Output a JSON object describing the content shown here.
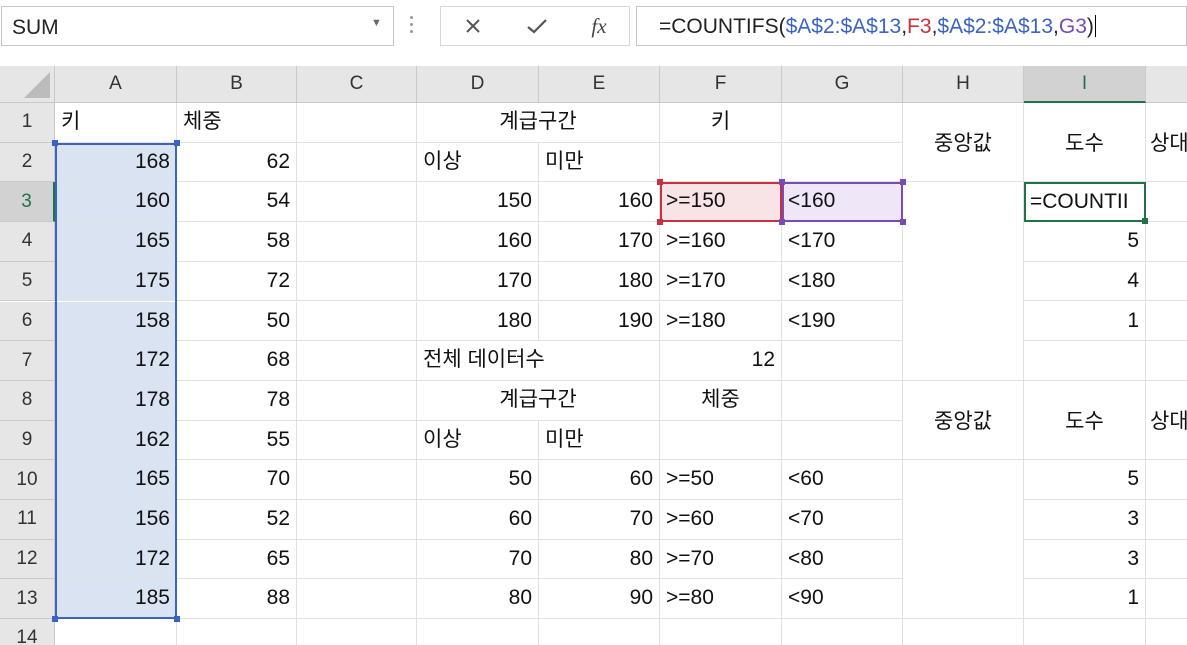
{
  "formula_bar": {
    "name_box": "SUM",
    "cancel_icon": "✕",
    "enter_icon": "✓",
    "fx_label": "fx",
    "formula_parts": [
      {
        "text": "=COUNTIFS(",
        "color": "#222222"
      },
      {
        "text": "$A$2:$A$13",
        "color": "#3b63c6"
      },
      {
        "text": ",",
        "color": "#222222"
      },
      {
        "text": "F3",
        "color": "#c8313f"
      },
      {
        "text": ",",
        "color": "#222222"
      },
      {
        "text": "$A$2:$A$13",
        "color": "#3b63c6"
      },
      {
        "text": ",",
        "color": "#222222"
      },
      {
        "text": "G3",
        "color": "#7a4bb3"
      },
      {
        "text": ")",
        "color": "#222222"
      }
    ]
  },
  "columns": [
    "A",
    "B",
    "C",
    "D",
    "E",
    "F",
    "G",
    "H",
    "I"
  ],
  "rows": [
    "1",
    "2",
    "3",
    "4",
    "5",
    "6",
    "7",
    "8",
    "9",
    "10",
    "11",
    "12",
    "13",
    "14"
  ],
  "active_cell_text": "=COUNTII",
  "cells": {
    "A1": "키",
    "B1": "체중",
    "D1": "계급구간",
    "F1": "키",
    "H1": "중앙값",
    "I1": "도수",
    "J1": "상대",
    "D2": "이상",
    "E2": "미만",
    "A2": "168",
    "B2": "62",
    "A3": "160",
    "B3": "54",
    "D3": "150",
    "E3": "160",
    "F3": ">=150",
    "G3": "<160",
    "A4": "165",
    "B4": "58",
    "D4": "160",
    "E4": "170",
    "F4": ">=160",
    "G4": "<170",
    "I4": "5",
    "A5": "175",
    "B5": "72",
    "D5": "170",
    "E5": "180",
    "F5": ">=170",
    "G5": "<180",
    "I5": "4",
    "A6": "158",
    "B6": "50",
    "D6": "180",
    "E6": "190",
    "F6": ">=180",
    "G6": "<190",
    "I6": "1",
    "A7": "172",
    "B7": "68",
    "D7": "전체 데이터수",
    "F7": "12",
    "A8": "178",
    "B8": "78",
    "D8": "계급구간",
    "F8": "체중",
    "H8": "중앙값",
    "I8": "도수",
    "J8": "상대",
    "A9": "162",
    "B9": "55",
    "D9": "이상",
    "E9": "미만",
    "A10": "165",
    "B10": "70",
    "D10": "50",
    "E10": "60",
    "F10": ">=50",
    "G10": "<60",
    "I10": "5",
    "A11": "156",
    "B11": "52",
    "D11": "60",
    "E11": "70",
    "F11": ">=60",
    "G11": "<70",
    "I11": "3",
    "A12": "172",
    "B12": "65",
    "D12": "70",
    "E12": "80",
    "F12": ">=70",
    "G12": "<80",
    "I12": "3",
    "A13": "185",
    "B13": "88",
    "D13": "80",
    "E13": "90",
    "F13": ">=80",
    "G13": "<90",
    "I13": "1"
  },
  "colors": {
    "range_blue": "#3b63c6",
    "ref_red": "#c8313f",
    "ref_purple": "#7a4bb3",
    "excel_green": "#217346"
  }
}
